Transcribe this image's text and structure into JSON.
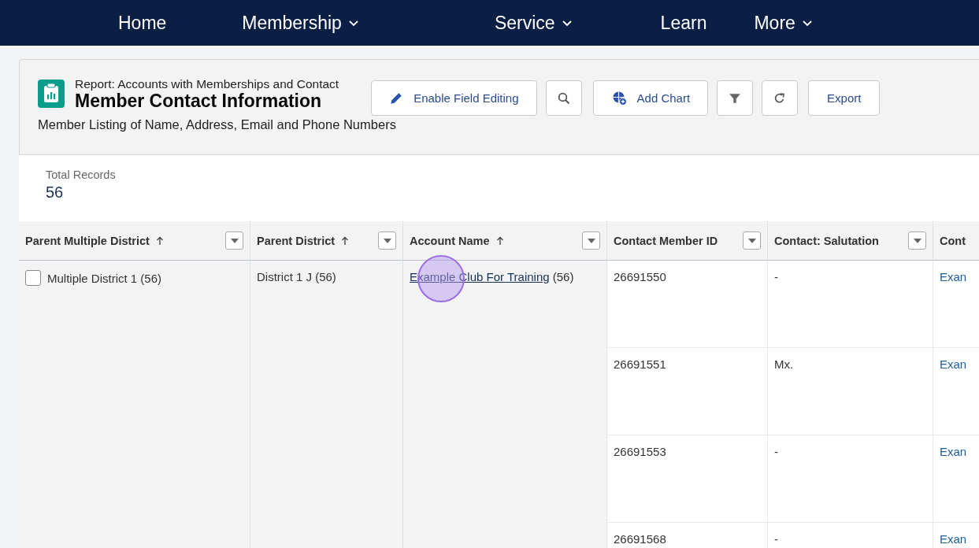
{
  "nav": {
    "items": [
      {
        "label": "Home",
        "dropdown": false
      },
      {
        "label": "Membership",
        "dropdown": true
      },
      {
        "label": "Service",
        "dropdown": true
      },
      {
        "label": "Learn",
        "dropdown": false
      },
      {
        "label": "More",
        "dropdown": true
      }
    ]
  },
  "report": {
    "type_label": "Report: Accounts with Memberships and Contact",
    "title": "Member Contact Information",
    "description": "Member Listing of Name, Address, Email and Phone Numbers"
  },
  "toolbar": [
    {
      "kind": "edit",
      "label": "Enable Field Editing"
    },
    {
      "kind": "search"
    },
    {
      "kind": "chart",
      "label": "Add Chart"
    },
    {
      "kind": "filter"
    },
    {
      "kind": "refresh"
    },
    {
      "kind": "plain",
      "label": "Export"
    }
  ],
  "summary": {
    "label": "Total Records",
    "value": "56"
  },
  "table": {
    "columns": [
      {
        "label": "Parent Multiple District",
        "sorted": true,
        "menu": true
      },
      {
        "label": "Parent District",
        "sorted": true,
        "menu": true
      },
      {
        "label": "Account Name",
        "sorted": true,
        "menu": true
      },
      {
        "label": "Contact Member ID",
        "sorted": false,
        "menu": true
      },
      {
        "label": "Contact: Salutation",
        "sorted": false,
        "menu": true
      },
      {
        "label": "Cont",
        "sorted": false,
        "menu": false
      }
    ],
    "groups": [
      {
        "kind": "checkbox",
        "checked": false,
        "text": "Multiple District 1",
        "count": "(56)"
      },
      {
        "kind": "plain",
        "text": "District 1 J",
        "count": "(56)"
      },
      {
        "kind": "link",
        "text": "Example Club For Training",
        "count": "(56)"
      }
    ],
    "rows": [
      {
        "cells": [
          {
            "kind": "plain",
            "text": "26691550"
          },
          {
            "kind": "plain",
            "text": "-"
          },
          {
            "kind": "link",
            "text": "Exan"
          }
        ]
      },
      {
        "cells": [
          {
            "kind": "plain",
            "text": "26691551"
          },
          {
            "kind": "plain",
            "text": "Mx."
          },
          {
            "kind": "link",
            "text": "Exan"
          }
        ]
      },
      {
        "cells": [
          {
            "kind": "plain",
            "text": "26691553"
          },
          {
            "kind": "plain",
            "text": "-"
          },
          {
            "kind": "link",
            "text": "Exan"
          }
        ]
      },
      {
        "cells": [
          {
            "kind": "plain",
            "text": "26691568"
          },
          {
            "kind": "plain",
            "text": "-"
          },
          {
            "kind": "link",
            "text": "Exan"
          }
        ]
      }
    ]
  },
  "click_highlight": {
    "shown": true
  }
}
